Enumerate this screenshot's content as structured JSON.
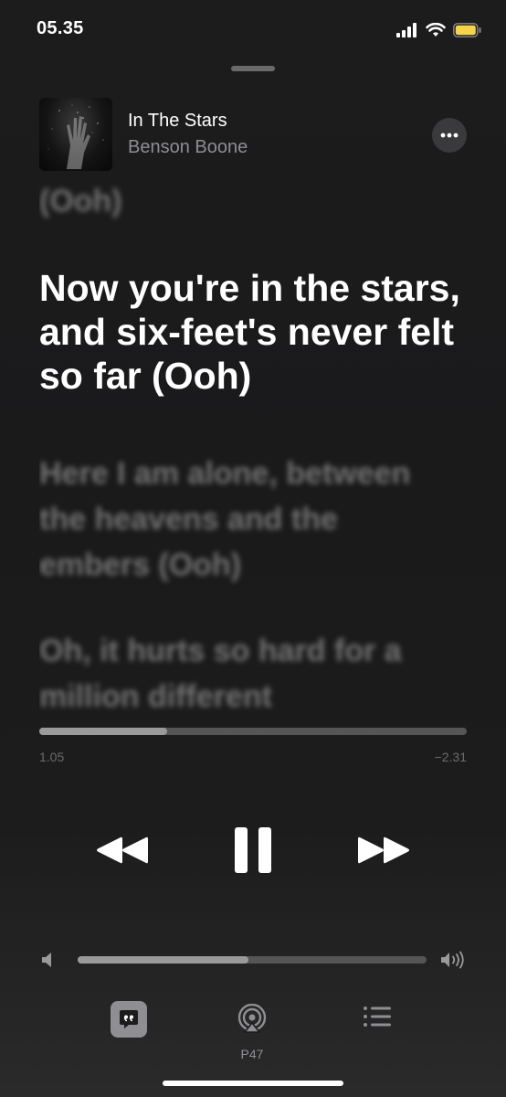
{
  "status_bar": {
    "time": "05.35"
  },
  "now_playing": {
    "title": "In The Stars",
    "artist": "Benson Boone"
  },
  "lyrics": {
    "previous": "(Ooh)",
    "current": "Now you're in the stars, and six-feet's never felt so far (Ooh)",
    "next": "Here I am alone, between the heavens and the embers (Ooh)",
    "next2": "Oh, it hurts so hard for a million different"
  },
  "playback": {
    "elapsed": "1.05",
    "remaining": "−2.31",
    "progress_fraction": 0.3,
    "volume_fraction": 0.49
  },
  "bottom_bar": {
    "airplay_label": "P47"
  },
  "icons": {
    "more": "ellipsis-icon",
    "rewind": "rewind-icon",
    "pause": "pause-icon",
    "forward": "fast-forward-icon",
    "lyrics": "quote-bubble-icon",
    "airplay": "airplay-icon",
    "queue": "list-icon"
  },
  "colors": {
    "background": "#1c1c1d",
    "secondary_text": "#8e8e93",
    "battery": "#f5d547"
  }
}
